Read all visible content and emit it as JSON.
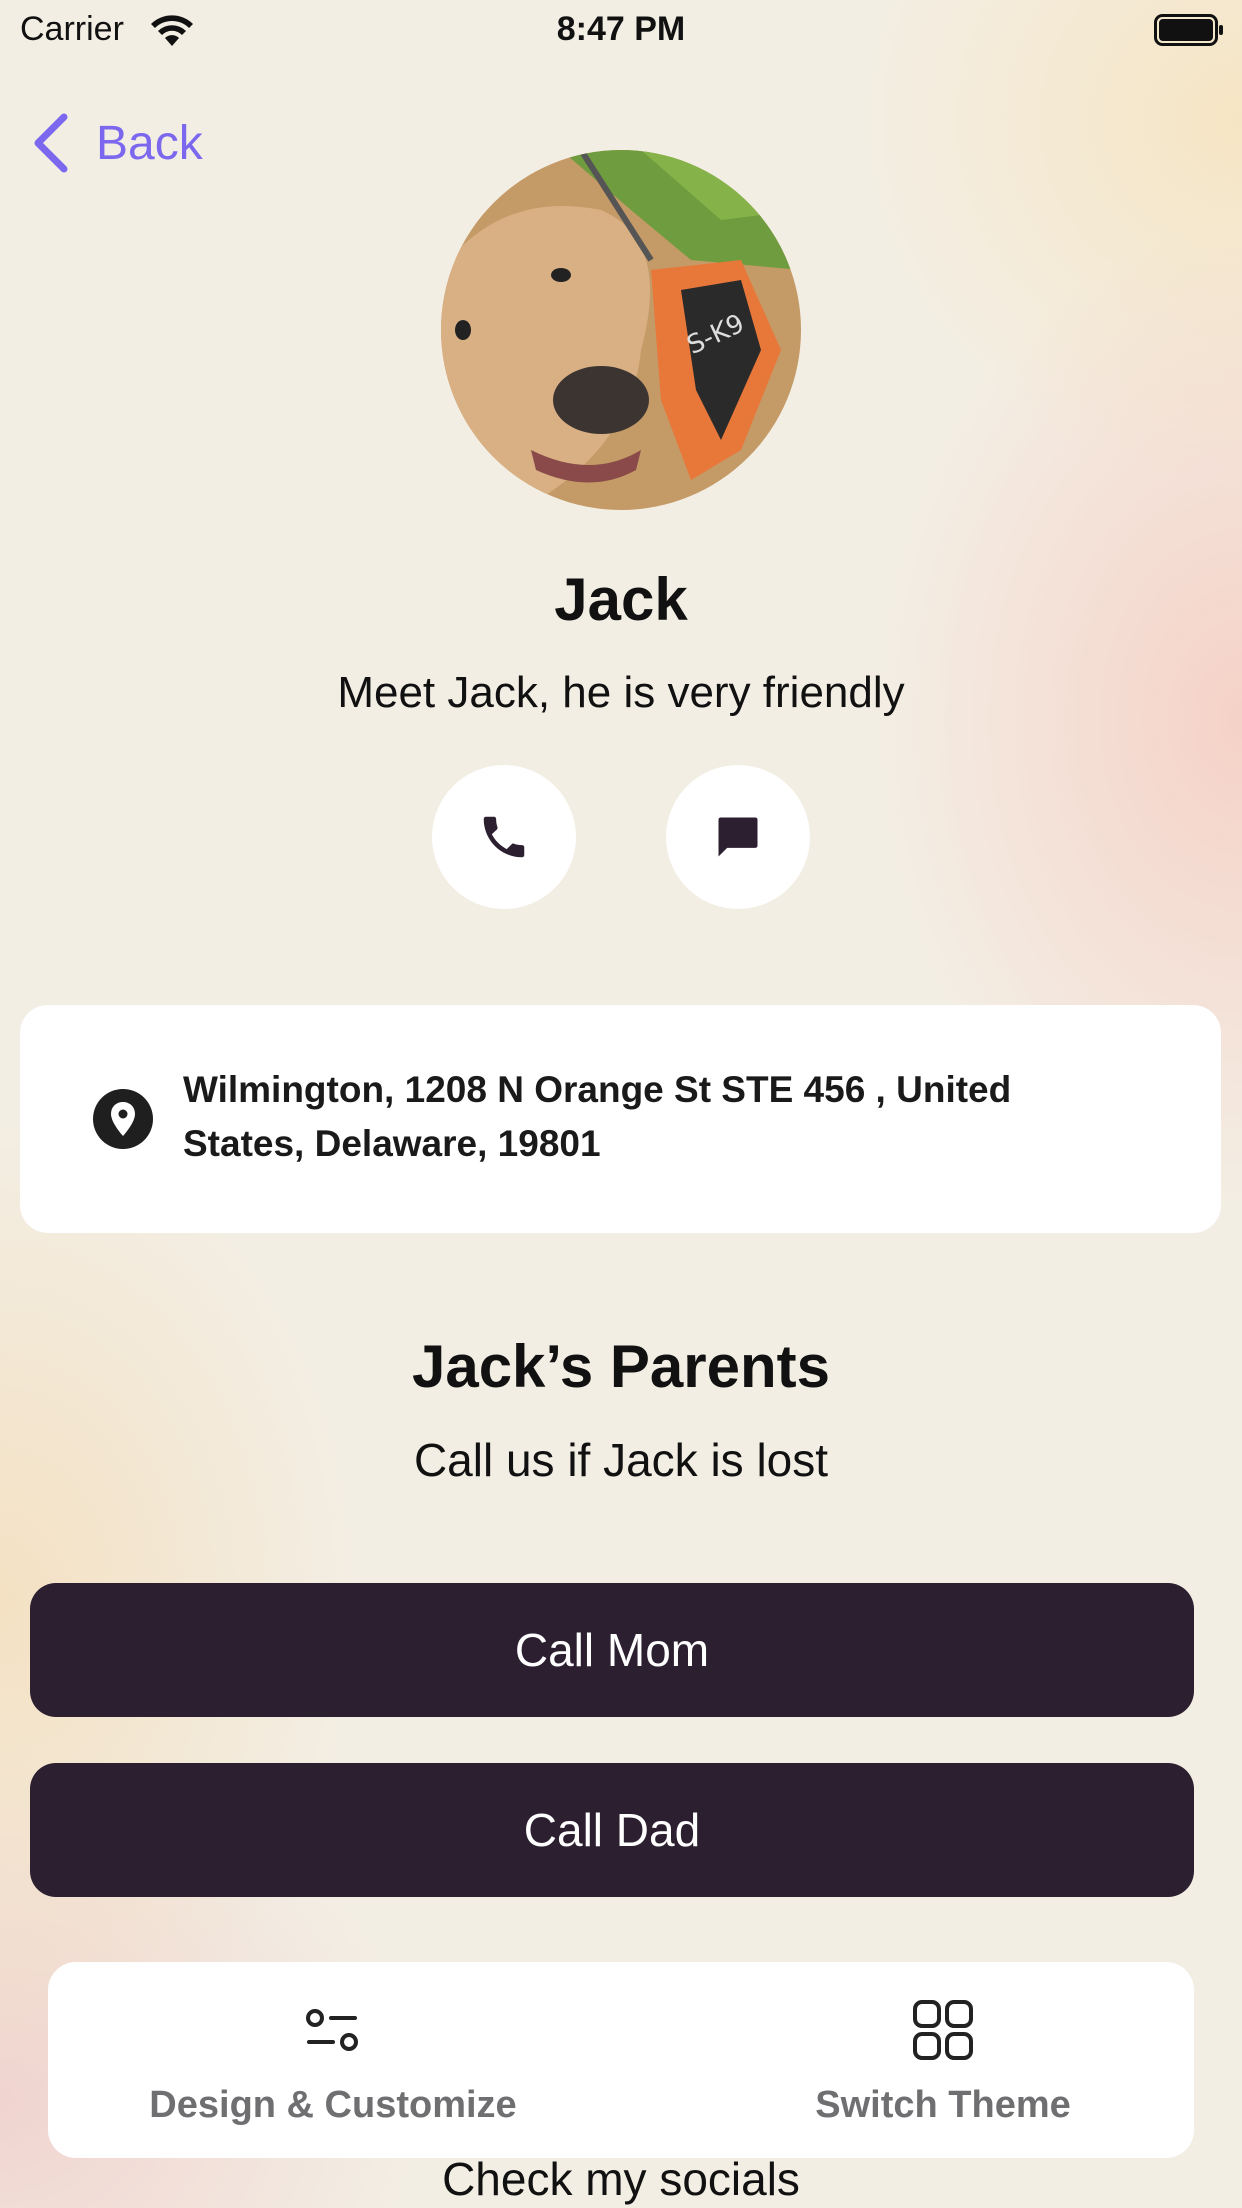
{
  "status_bar": {
    "carrier": "Carrier",
    "time": "8:47 PM"
  },
  "nav": {
    "back_label": "Back"
  },
  "profile": {
    "name": "Jack",
    "bio": "Meet Jack, he is very friendly"
  },
  "actions": {
    "call_icon": "phone-icon",
    "message_icon": "message-icon"
  },
  "address": {
    "icon": "location-pin-icon",
    "text": "Wilmington, 1208 N Orange St STE 456 , United States, Delaware, 19801"
  },
  "parents": {
    "title": "Jack’s Parents",
    "subtitle": "Call us if Jack is lost",
    "buttons": [
      {
        "label": "Call Mom"
      },
      {
        "label": "Call Dad"
      }
    ]
  },
  "socials": {
    "title": "Check my socials"
  },
  "bottom_bar": {
    "items": [
      {
        "label": "Design & Customize",
        "icon": "sliders-icon"
      },
      {
        "label": "Switch Theme",
        "icon": "grid-icon"
      }
    ]
  },
  "colors": {
    "accent": "#7b68ee",
    "button_dark": "#2b1f30",
    "background": "#f3eee4"
  }
}
